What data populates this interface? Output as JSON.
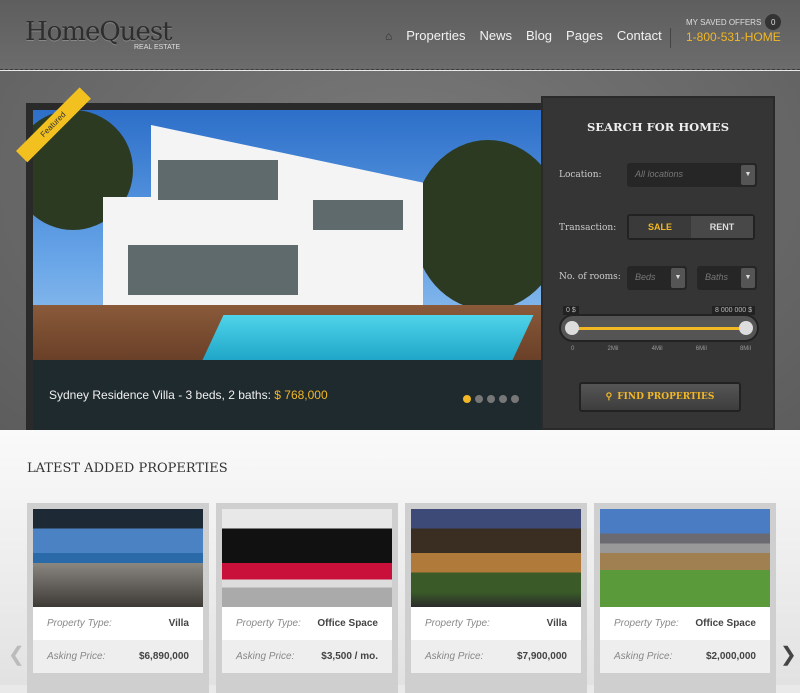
{
  "header": {
    "logo": "HomeQuest",
    "logo_sub": "REAL ESTATE",
    "nav": [
      "Properties",
      "News",
      "Blog",
      "Pages",
      "Contact"
    ],
    "home_icon": "home-icon",
    "saved_offers_label": "MY SAVED OFFERS",
    "saved_offers_count": "0",
    "phone": "1-800-531-HOME"
  },
  "featured": {
    "ribbon": "Featured",
    "caption": "Sydney Residence Villa - 3 beds, 2 baths:",
    "price": "$ 768,000",
    "slides": 5,
    "active_slide": 1
  },
  "search": {
    "title": "SEARCH FOR HOMES",
    "location_label": "Location:",
    "location_placeholder": "All locations",
    "transaction_label": "Transaction:",
    "sale": "SALE",
    "rent": "RENT",
    "selected_transaction": "SALE",
    "rooms_label": "No. of rooms:",
    "beds_placeholder": "Beds",
    "baths_placeholder": "Baths",
    "range_min": "0 $",
    "range_max": "8 000 000 $",
    "ticks": [
      "0",
      "2Mil",
      "4Mil",
      "6Mil",
      "8Mil"
    ],
    "button": "FIND PROPERTIES"
  },
  "latest": {
    "title": "LATEST ADDED PROPERTIES",
    "type_label": "Property Type:",
    "price_label": "Asking Price:",
    "cards": [
      {
        "type": "Villa",
        "price": "$6,890,000"
      },
      {
        "type": "Office Space",
        "price": "$3,500 / mo."
      },
      {
        "type": "Villa",
        "price": "$7,900,000"
      },
      {
        "type": "Office Space",
        "price": "$2,000,000"
      }
    ]
  },
  "colors": {
    "accent": "#f2b724"
  }
}
